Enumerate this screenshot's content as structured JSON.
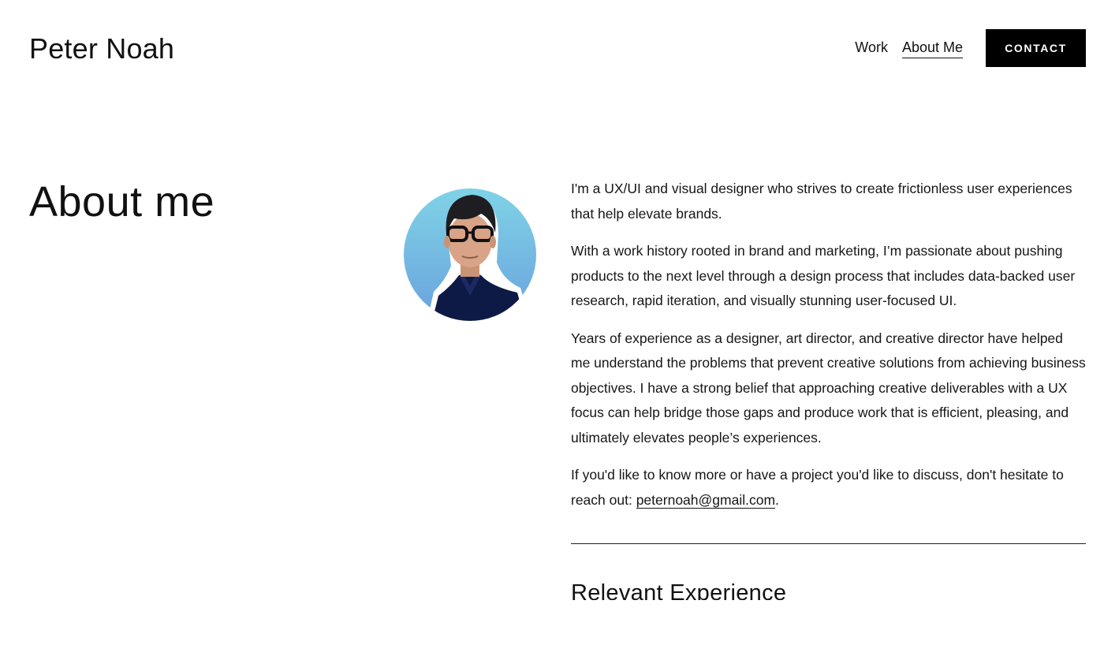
{
  "header": {
    "site_title": "Peter Noah",
    "nav": {
      "work_label": "Work",
      "about_label": "About Me",
      "active": "About Me"
    },
    "contact_label": "CONTACT"
  },
  "main": {
    "heading": "About me",
    "avatar_icon": "portrait-avatar",
    "paragraphs": [
      "I'm a UX/UI and visual designer who strives to create frictionless user experiences that help elevate brands.",
      "With a work history rooted in brand and marketing, I’m passionate about pushing products to the next level through a design process that includes data-backed user research, rapid iteration, and visually stunning user-focused UI.",
      "Years of experience as a designer, art director, and creative director have helped me understand the problems that prevent creative solutions from achieving business objectives. I have a strong belief that approaching creative deliverables with a UX focus can help bridge those gaps and produce work that is efficient, pleasing, and ultimately elevates people’s experiences."
    ],
    "contact_paragraph": {
      "prefix": "If you'd like to know more or have a project you'd like to discuss, don't hesitate to reach out: ",
      "email": "peternoah@gmail.com",
      "suffix": "."
    },
    "section_heading": "Relevant Experience"
  },
  "colors": {
    "text": "#111111",
    "background": "#ffffff",
    "button_bg": "#000000",
    "button_text": "#ffffff",
    "avatar_bg_top": "#7fd3e6",
    "avatar_bg_bottom": "#6aa2de",
    "shirt": "#0d1a45"
  }
}
